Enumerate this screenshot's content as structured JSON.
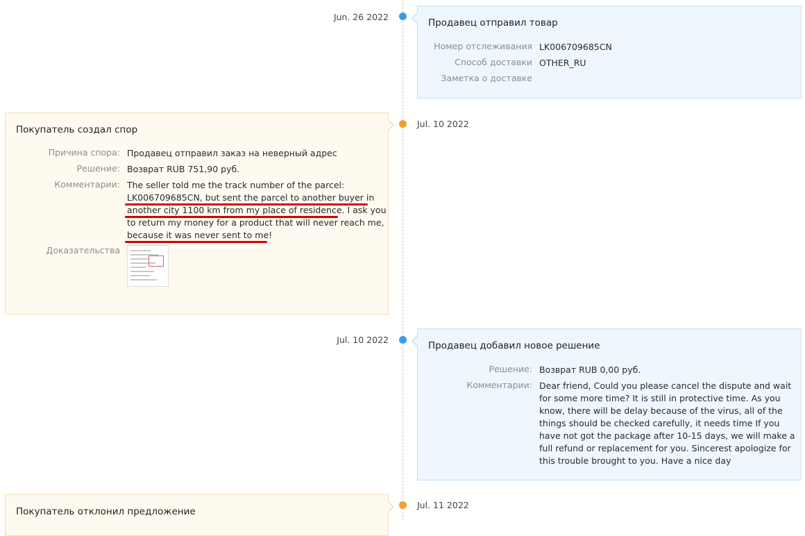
{
  "events": [
    {
      "date": "Jun. 26 2022",
      "title": "Продавец отправил товар",
      "rows": [
        {
          "label": "Номер отслеживания",
          "value": "LK006709685CN"
        },
        {
          "label": "Способ доставки",
          "value": "OTHER_RU"
        },
        {
          "label": "Заметка о доставке",
          "value": ""
        }
      ]
    },
    {
      "date": "Jul. 10 2022",
      "title": "Покупатель создал спор",
      "rows": [
        {
          "label": "Причина спора:",
          "value": "Продавец отправил заказ на неверный адрес"
        },
        {
          "label": "Решение:",
          "value": "Возврат RUB 751,90 руб."
        },
        {
          "label": "Комментарии:",
          "lines": [
            "The seller told me the track number of the parcel:",
            "LK006709685CN, but sent the parcel to another buyer in",
            "another city 1100 km from my place of residence. I ask you",
            "to return my money for a product that will never reach me,",
            "because it was never sent to me!"
          ]
        },
        {
          "label": "Доказательства"
        }
      ]
    },
    {
      "date": "Jul. 10 2022",
      "title": "Продавец добавил новое решение",
      "rows": [
        {
          "label": "Решение:",
          "value": "Возврат RUB 0,00 руб."
        },
        {
          "label": "Комментарии:",
          "lines": [
            "Dear friend, Could you please cancel the dispute and wait",
            "for some more time? It is still in protective time. As you",
            "know, there will be delay because of the virus, all of the",
            "things should be checked carefully, it needs time If you",
            "have not got the package after 10-15 days, we will make a",
            "full refund or replacement for you. Sincerest apologize for",
            "this trouble brought to you. Have a nice day"
          ]
        }
      ]
    },
    {
      "date": "Jul. 11 2022",
      "title": "Покупатель отклонил предложение"
    }
  ],
  "colors": {
    "seller_dot": "#3a9be4",
    "buyer_dot": "#f0a030",
    "seller_card_bg": "#eef7fd",
    "buyer_card_bg": "#fffaf0",
    "annotation_underline": "#d90000"
  }
}
